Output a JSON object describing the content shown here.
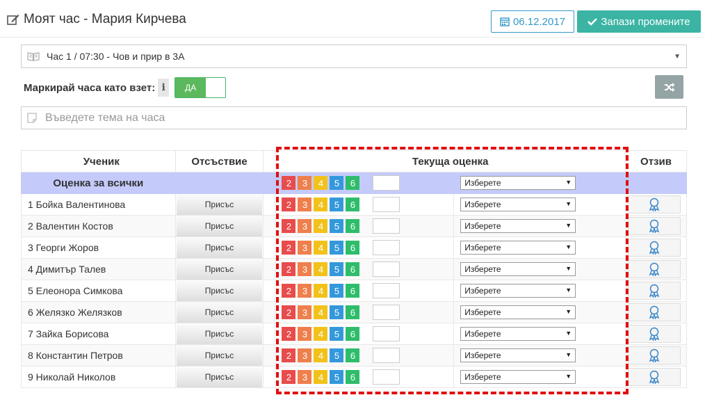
{
  "header": {
    "title": "Моят час - Мария Кирчева",
    "title_icon": "edit-icon",
    "date": "06.12.2017",
    "date_icon": "calendar-icon",
    "save_label": "Запази промените",
    "save_icon": "check-icon"
  },
  "lesson": {
    "value": "Час 1 / 07:30 - Чов и прир в 3А",
    "icon": "book-icon"
  },
  "mark": {
    "label": "Маркирай часа като взет:",
    "info_icon": "info-icon",
    "toggle_label": "ДА",
    "toggle_on": true
  },
  "shuffle_icon": "shuffle-icon",
  "topic": {
    "placeholder": "Въведете тема на часа",
    "icon": "note-icon"
  },
  "table": {
    "headers": {
      "student": "Ученик",
      "absence": "Отсъствие",
      "grade": "Текуща оценка",
      "feedback": "Отзив"
    },
    "all_row_label": "Оценка за всички",
    "grades": [
      "2",
      "3",
      "4",
      "5",
      "6"
    ],
    "grade_colors": [
      "#e84c4c",
      "#ef7f4c",
      "#f2c21b",
      "#3498db",
      "#2ebd6b"
    ],
    "select_placeholder": "Изберете",
    "feedback_icon": "award-icon",
    "students": [
      {
        "name": "1 Бойка Валентинова",
        "absence": "Присъс"
      },
      {
        "name": "2 Валентин Костов",
        "absence": "Присъс"
      },
      {
        "name": "3 Георги Жоров",
        "absence": "Присъс"
      },
      {
        "name": "4 Димитър Талев",
        "absence": "Присъс"
      },
      {
        "name": "5 Елеонора Симкова",
        "absence": "Присъс"
      },
      {
        "name": "6 Желязко Желязков",
        "absence": "Присъс"
      },
      {
        "name": "7 Зайка Борисова",
        "absence": "Присъс"
      },
      {
        "name": "8 Константин Петров",
        "absence": "Присъс"
      },
      {
        "name": "9 Николай Николов",
        "absence": "Присъс"
      }
    ]
  },
  "colors": {
    "accent_blue": "#3498c9",
    "save_green": "#3bb4a4",
    "toggle_green": "#5cb85c",
    "all_row_bg": "#c4cbfa",
    "highlight_dash": "#e01010"
  }
}
